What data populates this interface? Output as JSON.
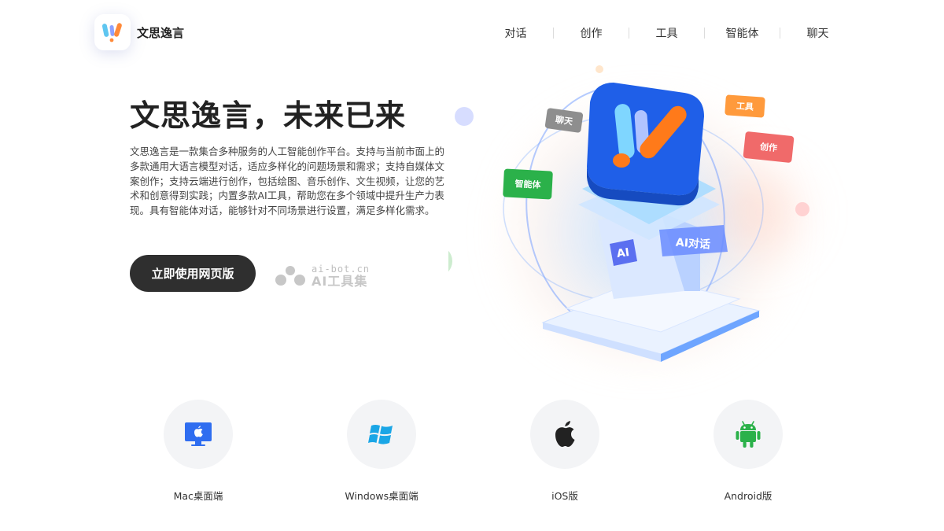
{
  "brand": {
    "name": "文思逸言"
  },
  "nav": {
    "items": [
      "对话",
      "创作",
      "工具",
      "智能体",
      "聊天"
    ]
  },
  "hero": {
    "title": "文思逸言，未来已来",
    "description": "文思逸言是一款集合多种服务的人工智能创作平台。支持与当前市面上的多款通用大语言模型对话，适应多样化的问题场景和需求；支持自媒体文案创作；支持云端进行创作，包括绘图、音乐创作、文生视频，让您的艺术和创意得到实践；内置多款AI工具，帮助您在多个领域中提升生产力表现。具有智能体对话，能够针对不同场景进行设置，满足多样化需求。",
    "cta_label": "立即使用网页版"
  },
  "watermark": {
    "url": "ai-bot.cn",
    "name": "AI工具集"
  },
  "illustration": {
    "tags": {
      "chat": "聊天",
      "tools": "工具",
      "create": "创作",
      "agent": "智能体",
      "ai_chat": "AI对话",
      "ai_badge": "AI"
    },
    "colors": {
      "brand_blue": "#1f5fe8",
      "orange": "#ff7a1a",
      "cyan": "#5fd3f5",
      "green": "#2bb14a",
      "red": "#f06a6a",
      "gray": "#9a9a9a"
    }
  },
  "downloads": [
    {
      "label": "Mac桌面端",
      "icon": "mac-monitor-icon"
    },
    {
      "label": "Windows桌面端",
      "icon": "windows-icon"
    },
    {
      "label": "iOS版",
      "icon": "apple-icon"
    },
    {
      "label": "Android版",
      "icon": "android-icon"
    }
  ]
}
